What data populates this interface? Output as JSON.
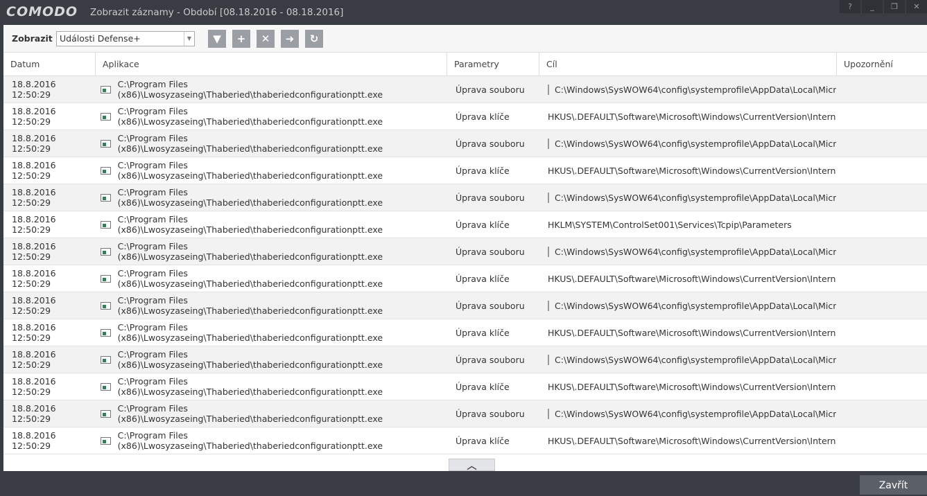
{
  "window": {
    "logo": "COMODO",
    "title": "Zobrazit záznamy - Období [08.18.2016 - 08.18.2016]",
    "help": "?",
    "minimize": "_",
    "restore": "❐",
    "close": "✕"
  },
  "toolbar": {
    "label": "Zobrazit",
    "select_value": "Události Defense+",
    "buttons": [
      {
        "icon": "filter-icon",
        "glyph": "▼"
      },
      {
        "icon": "plus-icon",
        "glyph": "+"
      },
      {
        "icon": "delete-icon",
        "glyph": "✕"
      },
      {
        "icon": "export-icon",
        "glyph": "➜"
      },
      {
        "icon": "refresh-icon",
        "glyph": "↻"
      }
    ]
  },
  "columns": [
    "Datum",
    "Aplikace",
    "Parametry",
    "Cíl",
    "Upozornění"
  ],
  "rows": [
    {
      "date": "18.8.2016 12:50:29",
      "app": "C:\\Program Files (x86)\\Lwosyzaseing\\Thaberied\\thaberiedconfigurationptt.exe",
      "param": "Úprava souboru",
      "target": "C:\\Windows\\SysWOW64\\config\\systemprofile\\AppData\\Local\\Micr...",
      "file": true
    },
    {
      "date": "18.8.2016 12:50:29",
      "app": "C:\\Program Files (x86)\\Lwosyzaseing\\Thaberied\\thaberiedconfigurationptt.exe",
      "param": "Úprava klíče",
      "target": "HKUS\\.DEFAULT\\Software\\Microsoft\\Windows\\CurrentVersion\\Intern...",
      "file": false
    },
    {
      "date": "18.8.2016 12:50:29",
      "app": "C:\\Program Files (x86)\\Lwosyzaseing\\Thaberied\\thaberiedconfigurationptt.exe",
      "param": "Úprava souboru",
      "target": "C:\\Windows\\SysWOW64\\config\\systemprofile\\AppData\\Local\\Micr...",
      "file": true
    },
    {
      "date": "18.8.2016 12:50:29",
      "app": "C:\\Program Files (x86)\\Lwosyzaseing\\Thaberied\\thaberiedconfigurationptt.exe",
      "param": "Úprava klíče",
      "target": "HKUS\\.DEFAULT\\Software\\Microsoft\\Windows\\CurrentVersion\\Intern...",
      "file": false
    },
    {
      "date": "18.8.2016 12:50:29",
      "app": "C:\\Program Files (x86)\\Lwosyzaseing\\Thaberied\\thaberiedconfigurationptt.exe",
      "param": "Úprava souboru",
      "target": "C:\\Windows\\SysWOW64\\config\\systemprofile\\AppData\\Local\\Micr...",
      "file": true
    },
    {
      "date": "18.8.2016 12:50:29",
      "app": "C:\\Program Files (x86)\\Lwosyzaseing\\Thaberied\\thaberiedconfigurationptt.exe",
      "param": "Úprava klíče",
      "target": "HKLM\\SYSTEM\\ControlSet001\\Services\\Tcpip\\Parameters",
      "file": false
    },
    {
      "date": "18.8.2016 12:50:29",
      "app": "C:\\Program Files (x86)\\Lwosyzaseing\\Thaberied\\thaberiedconfigurationptt.exe",
      "param": "Úprava souboru",
      "target": "C:\\Windows\\SysWOW64\\config\\systemprofile\\AppData\\Local\\Micr...",
      "file": true
    },
    {
      "date": "18.8.2016 12:50:29",
      "app": "C:\\Program Files (x86)\\Lwosyzaseing\\Thaberied\\thaberiedconfigurationptt.exe",
      "param": "Úprava klíče",
      "target": "HKUS\\.DEFAULT\\Software\\Microsoft\\Windows\\CurrentVersion\\Intern...",
      "file": false
    },
    {
      "date": "18.8.2016 12:50:29",
      "app": "C:\\Program Files (x86)\\Lwosyzaseing\\Thaberied\\thaberiedconfigurationptt.exe",
      "param": "Úprava souboru",
      "target": "C:\\Windows\\SysWOW64\\config\\systemprofile\\AppData\\Local\\Micr...",
      "file": true
    },
    {
      "date": "18.8.2016 12:50:29",
      "app": "C:\\Program Files (x86)\\Lwosyzaseing\\Thaberied\\thaberiedconfigurationptt.exe",
      "param": "Úprava klíče",
      "target": "HKUS\\.DEFAULT\\Software\\Microsoft\\Windows\\CurrentVersion\\Intern...",
      "file": false
    },
    {
      "date": "18.8.2016 12:50:29",
      "app": "C:\\Program Files (x86)\\Lwosyzaseing\\Thaberied\\thaberiedconfigurationptt.exe",
      "param": "Úprava souboru",
      "target": "C:\\Windows\\SysWOW64\\config\\systemprofile\\AppData\\Local\\Micr...",
      "file": true
    },
    {
      "date": "18.8.2016 12:50:29",
      "app": "C:\\Program Files (x86)\\Lwosyzaseing\\Thaberied\\thaberiedconfigurationptt.exe",
      "param": "Úprava klíče",
      "target": "HKUS\\.DEFAULT\\Software\\Microsoft\\Windows\\CurrentVersion\\Intern...",
      "file": false
    },
    {
      "date": "18.8.2016 12:50:29",
      "app": "C:\\Program Files (x86)\\Lwosyzaseing\\Thaberied\\thaberiedconfigurationptt.exe",
      "param": "Úprava souboru",
      "target": "C:\\Windows\\SysWOW64\\config\\systemprofile\\AppData\\Local\\Micr...",
      "file": true
    },
    {
      "date": "18.8.2016 12:50:29",
      "app": "C:\\Program Files (x86)\\Lwosyzaseing\\Thaberied\\thaberiedconfigurationptt.exe",
      "param": "Úprava klíče",
      "target": "HKUS\\.DEFAULT\\Software\\Microsoft\\Windows\\CurrentVersion\\Intern...",
      "file": false
    }
  ],
  "footer": {
    "collapse_glyph": "︿",
    "close_label": "Zavřít"
  }
}
